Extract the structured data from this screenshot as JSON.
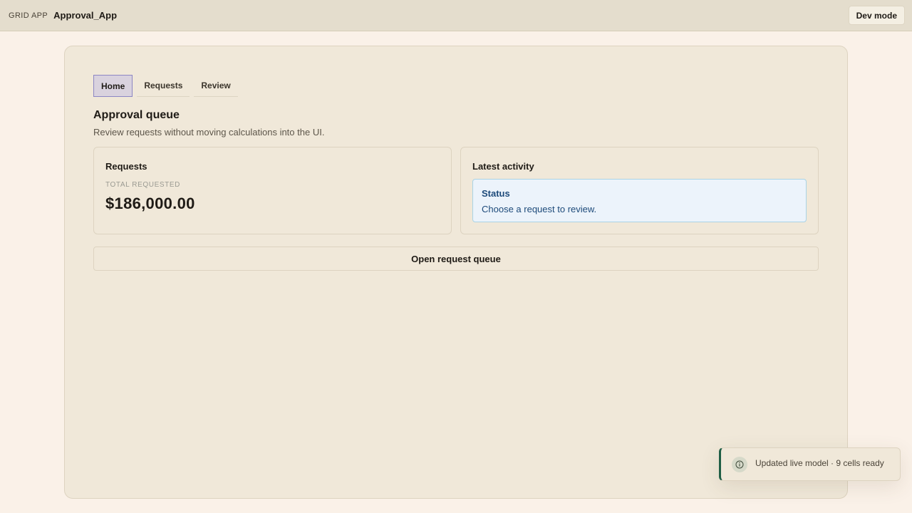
{
  "topbar": {
    "brand": "GRID APP",
    "app_title": "Approval_App",
    "dev_mode_label": "Dev mode"
  },
  "tabs": [
    {
      "label": "Home",
      "active": true
    },
    {
      "label": "Requests",
      "active": false
    },
    {
      "label": "Review",
      "active": false
    }
  ],
  "main": {
    "title": "Approval queue",
    "subtitle": "Review requests without moving calculations into the UI."
  },
  "requests_card": {
    "title": "Requests",
    "metric_label": "TOTAL REQUESTED",
    "metric_value": "$186,000.00"
  },
  "activity_card": {
    "title": "Latest activity",
    "status_title": "Status",
    "status_text": "Choose a request to review."
  },
  "queue_button_label": "Open request queue",
  "toast": {
    "icon": "info-icon",
    "text": "Updated live model · 9 cells ready",
    "accent_color": "#1f5e45"
  },
  "colors": {
    "background": "#faf1e8",
    "panel": "#f0e8d9",
    "active_tab_border": "#8c86c4",
    "status_text": "#1d4a7a"
  }
}
